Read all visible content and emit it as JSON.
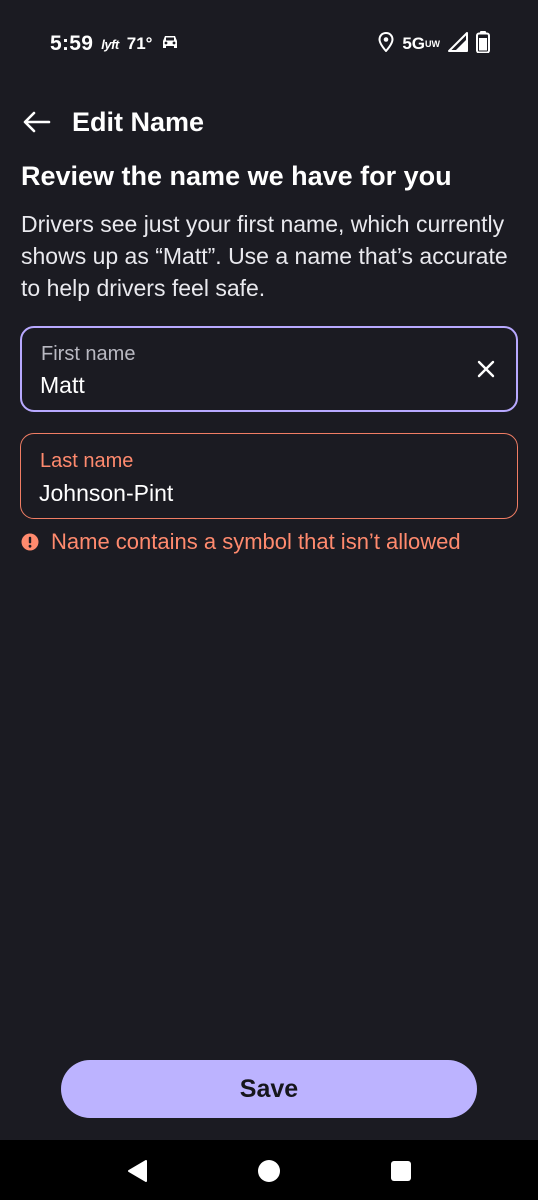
{
  "status_bar": {
    "time": "5:59",
    "lyft_label": "lyft",
    "temperature": "71°",
    "network": "5G",
    "network_sub": "UW"
  },
  "header": {
    "title": "Edit Name"
  },
  "content": {
    "heading": "Review the name we have for you",
    "description": "Drivers see just your first name, which currently shows up as “Matt”. Use a name that’s accurate to help drivers feel safe."
  },
  "first_name": {
    "label": "First name",
    "value": "Matt"
  },
  "last_name": {
    "label": "Last name",
    "value": "Johnson-Pint"
  },
  "error": {
    "message": "Name contains a symbol that isn’t allowed"
  },
  "footer": {
    "save_label": "Save"
  },
  "colors": {
    "background": "#1b1b22",
    "accent": "#bcb3ff",
    "focus_border": "#b8a9ff",
    "error": "#ff8a6e"
  }
}
